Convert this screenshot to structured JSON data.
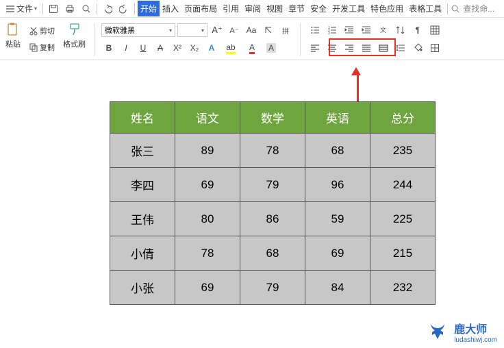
{
  "menubar": {
    "file_label": "文件",
    "tabs": [
      "开始",
      "插入",
      "页面布局",
      "引用",
      "审阅",
      "视图",
      "章节",
      "安全",
      "开发工具",
      "特色应用",
      "表格工具"
    ],
    "active_tab_index": 0,
    "search_placeholder": "查找命..."
  },
  "toolbar": {
    "paste_label": "粘贴",
    "cut_label": "剪切",
    "copy_label": "复制",
    "format_painter_label": "格式刷",
    "font_name": "微软雅黑",
    "font_size": ""
  },
  "table": {
    "headers": [
      "姓名",
      "语文",
      "数学",
      "英语",
      "总分"
    ],
    "rows": [
      [
        "张三",
        "89",
        "78",
        "68",
        "235"
      ],
      [
        "李四",
        "69",
        "79",
        "96",
        "244"
      ],
      [
        "王伟",
        "80",
        "86",
        "59",
        "225"
      ],
      [
        "小倩",
        "78",
        "68",
        "69",
        "215"
      ],
      [
        "小张",
        "69",
        "79",
        "84",
        "232"
      ]
    ]
  },
  "watermark": {
    "brand": "鹿大师",
    "domain": "ludashiwj.com"
  }
}
